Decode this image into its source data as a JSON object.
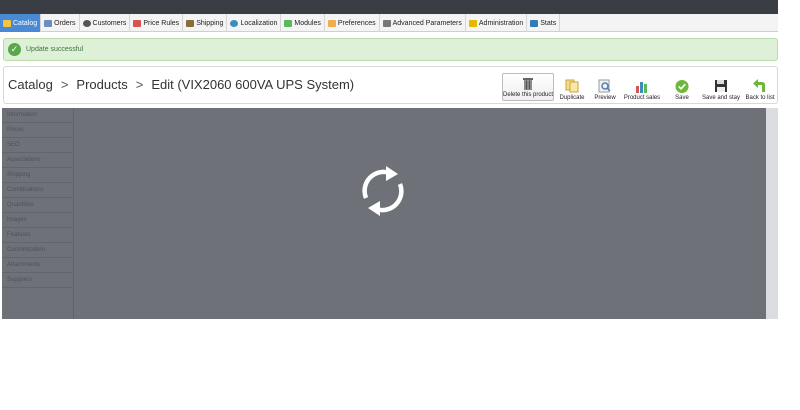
{
  "menu": {
    "items": [
      {
        "label": "Catalog",
        "color": "#f5c542",
        "active": true
      },
      {
        "label": "Orders",
        "color": "#6c8ebf"
      },
      {
        "label": "Customers",
        "color": "#555555"
      },
      {
        "label": "Price Rules",
        "color": "#d9534f"
      },
      {
        "label": "Shipping",
        "color": "#8a6d3b"
      },
      {
        "label": "Localization",
        "color": "#3c8dbc"
      },
      {
        "label": "Modules",
        "color": "#5cb85c"
      },
      {
        "label": "Preferences",
        "color": "#f0ad4e"
      },
      {
        "label": "Advanced Parameters",
        "color": "#777777"
      },
      {
        "label": "Administration",
        "color": "#e6b800"
      },
      {
        "label": "Stats",
        "color": "#337ab7"
      }
    ]
  },
  "alert": {
    "text": "Update successful",
    "color": "#dff0d8"
  },
  "breadcrumb": {
    "items": [
      "Catalog",
      "Products",
      "Edit (VIX2060 600VA UPS System)"
    ],
    "separator": ">"
  },
  "toolbar": {
    "delete_label": "Delete this product",
    "duplicate_label": "Duplicate",
    "preview_label": "Preview",
    "sales_label": "Product sales",
    "save_label": "Save",
    "save_stay_label": "Save and stay",
    "back_label": "Back to list"
  },
  "sidebar": {
    "items": [
      "Information",
      "Prices",
      "SEO",
      "Associations",
      "Shipping",
      "Combinations",
      "Quantities",
      "Images",
      "Features",
      "Customization",
      "Attachments",
      "Suppliers"
    ]
  },
  "overlay": {
    "color": "#6e7178",
    "icon": "refresh-spinner-icon"
  }
}
